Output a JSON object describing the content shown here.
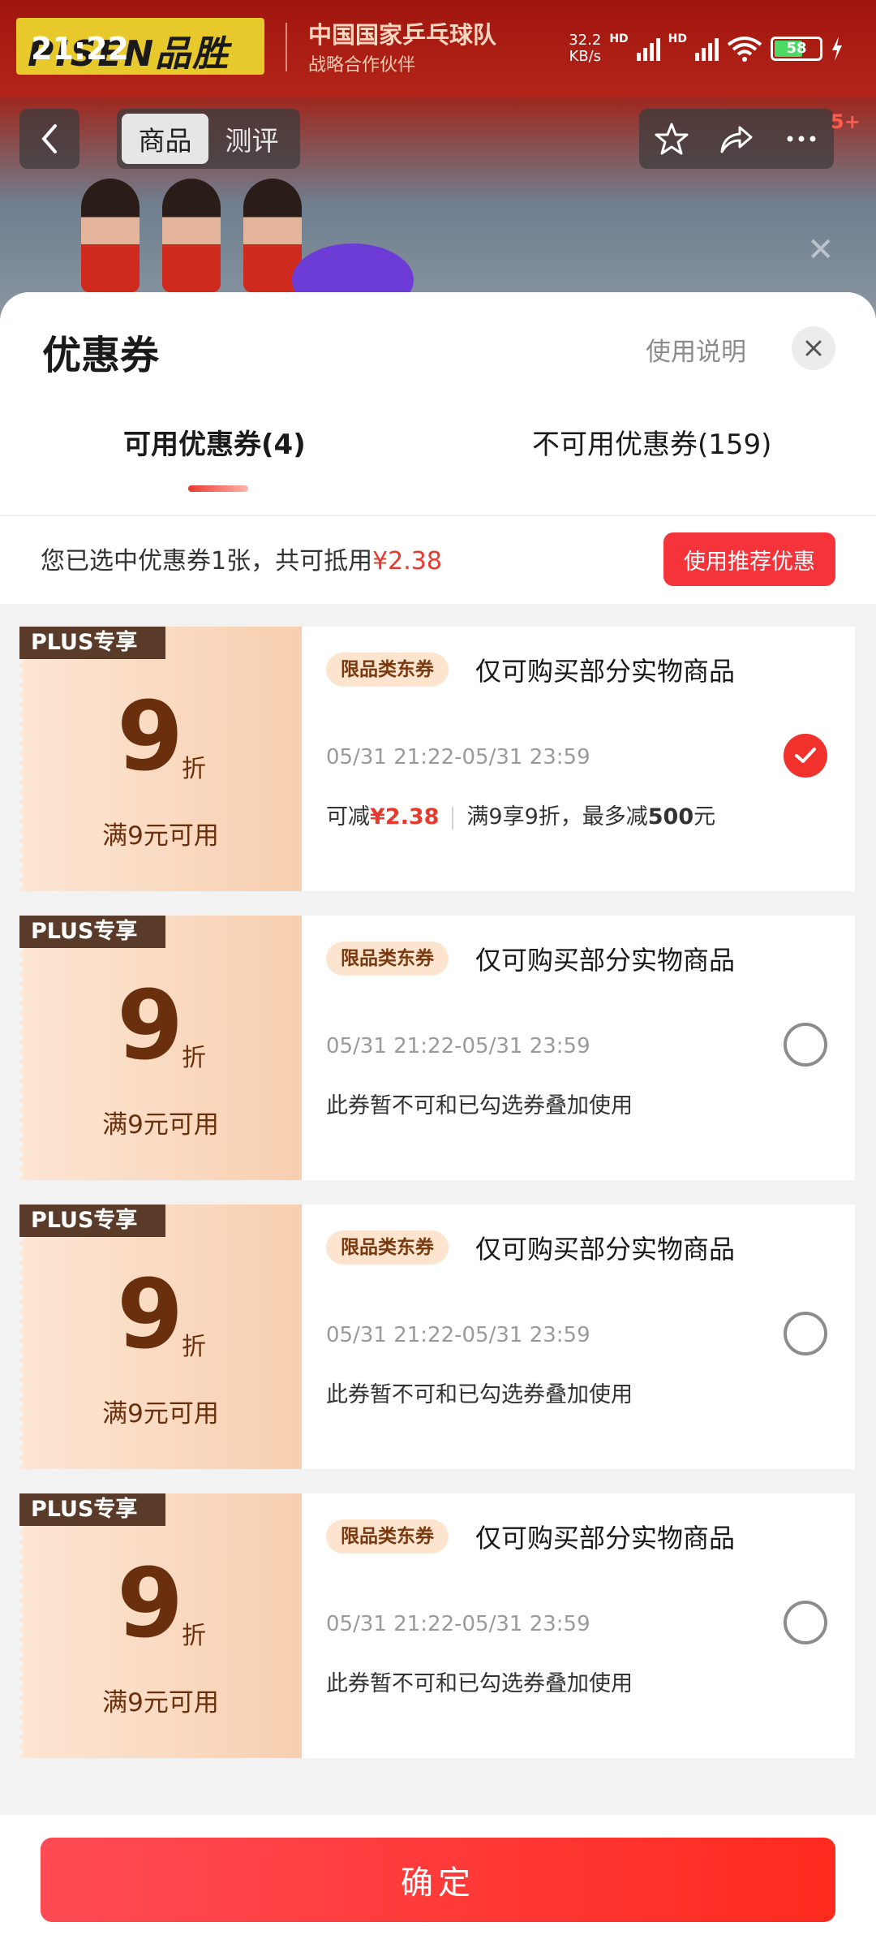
{
  "status_bar": {
    "time": "21:22",
    "net_speed_value": "32.2",
    "net_speed_unit": "KB/s",
    "hd1": "HD",
    "hd2": "HD",
    "battery": "58"
  },
  "background": {
    "brand": "PISEN品胜",
    "partner_title": "中国国家乒乓球队",
    "partner_sub": "战略合作伙伴",
    "tabs": [
      "商品",
      "测评"
    ],
    "badge": "5+"
  },
  "sheet": {
    "title": "优惠券",
    "help": "使用说明",
    "tab_available": "可用优惠券(4)",
    "tab_unavailable": "不可用优惠券(159)",
    "summary_prefix": "您已选中优惠券1张，共可抵用",
    "summary_amount": "¥2.38",
    "recommend_button": "使用推荐优惠",
    "confirm_button": "确定"
  },
  "coupons": [
    {
      "tag": "PLUS专享",
      "number": "9",
      "unit": "折",
      "threshold": "满9元可用",
      "type": "限品类东券",
      "scope": "仅可购买部分实物商品",
      "validity": "05/31 21:22-05/31 23:59",
      "note_prefix": "可减",
      "note_amount": "¥2.38",
      "note_rule_a": "满9享9折，最多减",
      "note_rule_b": "500",
      "note_rule_c": "元",
      "checked": true
    },
    {
      "tag": "PLUS专享",
      "number": "9",
      "unit": "折",
      "threshold": "满9元可用",
      "type": "限品类东券",
      "scope": "仅可购买部分实物商品",
      "validity": "05/31 21:22-05/31 23:59",
      "note": "此券暂不可和已勾选券叠加使用",
      "checked": false
    },
    {
      "tag": "PLUS专享",
      "number": "9",
      "unit": "折",
      "threshold": "满9元可用",
      "type": "限品类东券",
      "scope": "仅可购买部分实物商品",
      "validity": "05/31 21:22-05/31 23:59",
      "note": "此券暂不可和已勾选券叠加使用",
      "checked": false
    },
    {
      "tag": "PLUS专享",
      "number": "9",
      "unit": "折",
      "threshold": "满9元可用",
      "type": "限品类东券",
      "scope": "仅可购买部分实物商品",
      "validity": "05/31 21:22-05/31 23:59",
      "note": "此券暂不可和已勾选券叠加使用",
      "checked": false
    }
  ],
  "colors": {
    "accent": "#f0312c",
    "coupon_bg": "#f7cfb0",
    "coupon_text": "#6a2f0c"
  }
}
